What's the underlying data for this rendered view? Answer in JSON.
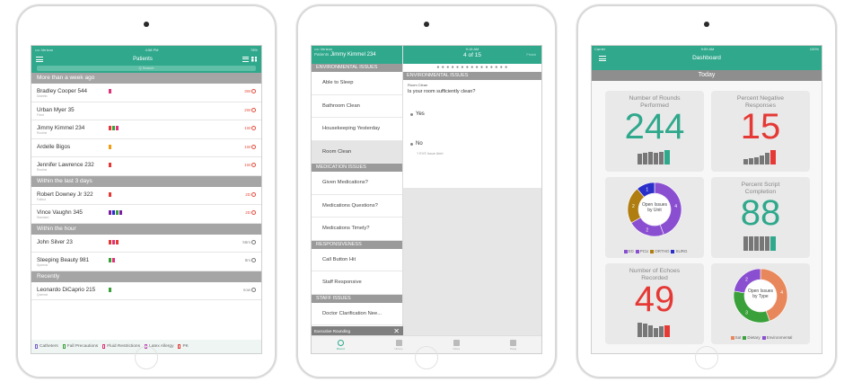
{
  "colors": {
    "teal": "#2fa88c",
    "red": "#e53935",
    "purple": "#8a4fd1",
    "orange": "#e8875c",
    "green": "#3aa03a",
    "blue": "#2b2fc9",
    "olive": "#b07d10"
  },
  "screen1": {
    "title": "Patients",
    "search_placeholder": "Q Search",
    "status_left": "•••• Verizon",
    "status_time": "4:58 PM",
    "status_right": "78%",
    "sections": [
      {
        "label": "More than a week ago",
        "rows": [
          {
            "name": "Bradley Cooper",
            "room": "544",
            "sub": "Diabetic",
            "flags": [
              "#e0337a"
            ],
            "time": "3W",
            "alert": true
          },
          {
            "name": "Urban Myer",
            "room": "35",
            "sub": "Fixed",
            "flags": [],
            "time": "2W",
            "alert": true
          },
          {
            "name": "Jimmy Kimmel",
            "room": "234",
            "sub": "Routine",
            "flags": [
              "#e53935",
              "#3aa03a",
              "#e0337a"
            ],
            "time": "1W",
            "alert": true
          },
          {
            "name": "Ardelle",
            "room": "Bigos",
            "sub": "",
            "flags": [
              "#f39c12"
            ],
            "time": "1W",
            "alert": true
          },
          {
            "name": "Jennifer Lawrence",
            "room": "232",
            "sub": "Routine",
            "flags": [
              "#e53935"
            ],
            "time": "1W",
            "alert": true
          }
        ]
      },
      {
        "label": "Within the last 3 days",
        "rows": [
          {
            "name": "Robert Downey Jr",
            "room": "322",
            "sub": "Fallout",
            "flags": [
              "#e53935"
            ],
            "time": "2D",
            "alert": true
          },
          {
            "name": "Vince Vaughn",
            "room": "345",
            "sub": "Standard",
            "flags": [
              "#7b1fa2",
              "#2b2fc9",
              "#3aa03a",
              "#7b1fa2"
            ],
            "time": "2D",
            "alert": true
          }
        ]
      },
      {
        "label": "Within the hour",
        "rows": [
          {
            "name": "John Silver",
            "room": "23",
            "sub": "",
            "flags": [
              "#e53935",
              "#e0337a",
              "#e53935"
            ],
            "time": "56m",
            "alert": false
          },
          {
            "name": "Sleeping Beauty",
            "room": "981",
            "sub": "Sparrow",
            "flags": [
              "#3aa03a",
              "#e0337a"
            ],
            "time": "8m",
            "alert": false
          }
        ]
      },
      {
        "label": "Recently",
        "rows": [
          {
            "name": "Leonardo DiCaprio",
            "room": "215",
            "sub": "Quereat",
            "flags": [
              "#3aa03a"
            ],
            "time": "now",
            "alert": false
          }
        ]
      }
    ],
    "legend": [
      {
        "label": "Catheters",
        "color": "#7b5cc9"
      },
      {
        "label": "Fall Precautions",
        "color": "#3aa03a"
      },
      {
        "label": "Fluid Restrictions",
        "color": "#e0337a"
      },
      {
        "label": "Latex Allergy",
        "color": "#c04bb8"
      },
      {
        "label": "PK",
        "color": "#e53935"
      }
    ]
  },
  "screen2": {
    "status_left": "•••• Verizon",
    "status_time": "9:16 AM",
    "status_right": "57%",
    "back": "Patients",
    "patient": "Jimmy Kimmel 234",
    "counter": "4 of 15",
    "finish": "Finish",
    "groups": [
      {
        "label": "ENVIRONMENTAL ISSUES",
        "items": [
          "Able to Sleep",
          "Bathroom Clean",
          "Housekeeping Yesterday",
          "Room Clean"
        ]
      },
      {
        "label": "MEDICATION ISSUES",
        "items": [
          "Given Medications?",
          "Medications Questions?",
          "Medications Timely?"
        ]
      },
      {
        "label": "RESPONSIVENESS",
        "items": [
          "Call Button Hit",
          "Staff Responsive"
        ]
      },
      {
        "label": "STAFF ISSUES",
        "items": [
          "Doctor Clarification Nee..."
        ]
      }
    ],
    "selected_index": 3,
    "exec_label": "Executive Rounding",
    "exec_close": "✕",
    "right_section": "ENVIRONMENTAL ISSUES",
    "question_category": "Room Clean",
    "question": "Is your room sufficiently clean?",
    "opt_yes": "Yes",
    "opt_no": "No",
    "issue_alert": "? EVS Issue Alert",
    "tabs": [
      "Round",
      "History",
      "Notes",
      "Flags"
    ]
  },
  "screen3": {
    "status_left": "Carrier",
    "status_time": "9:59 AM",
    "status_right": "100%",
    "title": "Dashboard",
    "period": "Today",
    "cards": {
      "rounds": {
        "title": "Number of Rounds Performed",
        "value": "244",
        "color": "#2fa88c"
      },
      "negative": {
        "title": "Percent Negative Responses",
        "value": "15",
        "color": "#e53935"
      },
      "script": {
        "title": "Percent Script Completion",
        "value": "88",
        "color": "#2fa88c"
      },
      "echoes": {
        "title": "Number of Echoes Recorded",
        "value": "49",
        "color": "#e53935"
      }
    },
    "donut_unit": {
      "center": "Open Issues by Unit",
      "slices": [
        {
          "label": "ED",
          "value": 4,
          "color": "#8a4fd1"
        },
        {
          "label": "PCU",
          "value": 2,
          "color": "#8a4fd1"
        },
        {
          "label": "ORTHO",
          "value": 2,
          "color": "#b07d10"
        },
        {
          "label": "SURG",
          "value": 1,
          "color": "#2b2fc9"
        }
      ],
      "legend": [
        "ED",
        "PCU",
        "ORTHO",
        "SURG"
      ],
      "legend_colors": [
        "#8a4fd1",
        "#8a4fd1",
        "#b07d10",
        "#2b2fc9"
      ]
    },
    "donut_type": {
      "center": "Open Issues by Type",
      "slices": [
        {
          "label": "Sat",
          "value": 4,
          "color": "#e8875c"
        },
        {
          "label": "Dietary",
          "value": 3,
          "color": "#3aa03a"
        },
        {
          "label": "Environmental",
          "value": 2,
          "color": "#8a4fd1"
        }
      ],
      "legend": [
        "Sat",
        "Dietary",
        "Environmental"
      ],
      "legend_colors": [
        "#e8875c",
        "#3aa03a",
        "#8a4fd1"
      ]
    }
  }
}
